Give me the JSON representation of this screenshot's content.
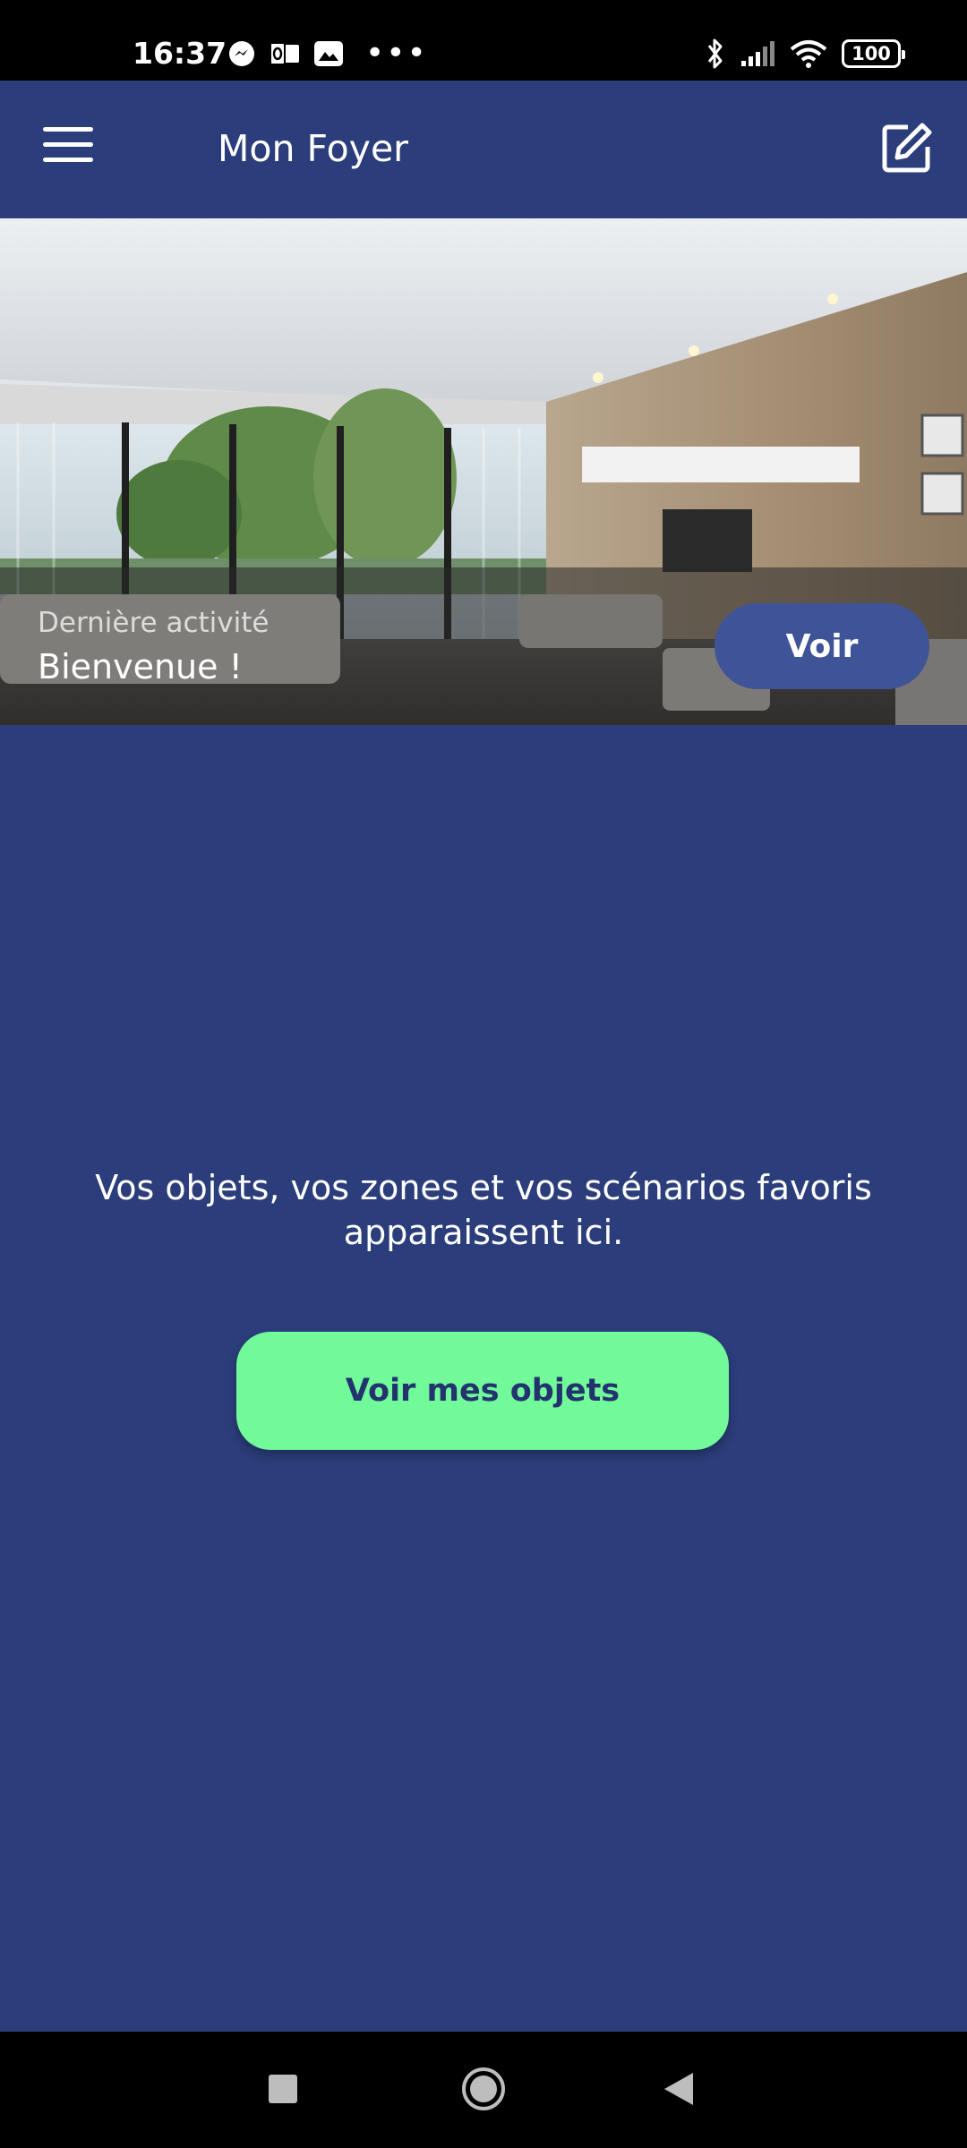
{
  "status_bar": {
    "time": "16:37",
    "battery": "100",
    "left_icons": [
      "messenger-icon",
      "outlook-icon",
      "image-icon",
      "more-dots-icon"
    ],
    "right_icons": [
      "bluetooth-icon",
      "signal-icon",
      "wifi-icon",
      "battery-icon"
    ]
  },
  "app_bar": {
    "title": "Mon Foyer",
    "menu_icon": "hamburger-menu-icon",
    "action_icon": "edit-icon"
  },
  "hero": {
    "activity_label": "Dernière activité",
    "activity_value": "Bienvenue !",
    "button_label": "Voir"
  },
  "main": {
    "empty_message": "Vos objets, vos zones et vos scénarios favoris apparaissent ici.",
    "primary_button_label": "Voir mes objets"
  },
  "colors": {
    "background": "#2b3d7a",
    "primary_button": "#72f99a",
    "primary_button_text": "#22336e",
    "secondary_button": "#3f5498"
  },
  "nav_bar": {
    "icons": [
      "recents-icon",
      "home-icon",
      "back-icon"
    ]
  }
}
